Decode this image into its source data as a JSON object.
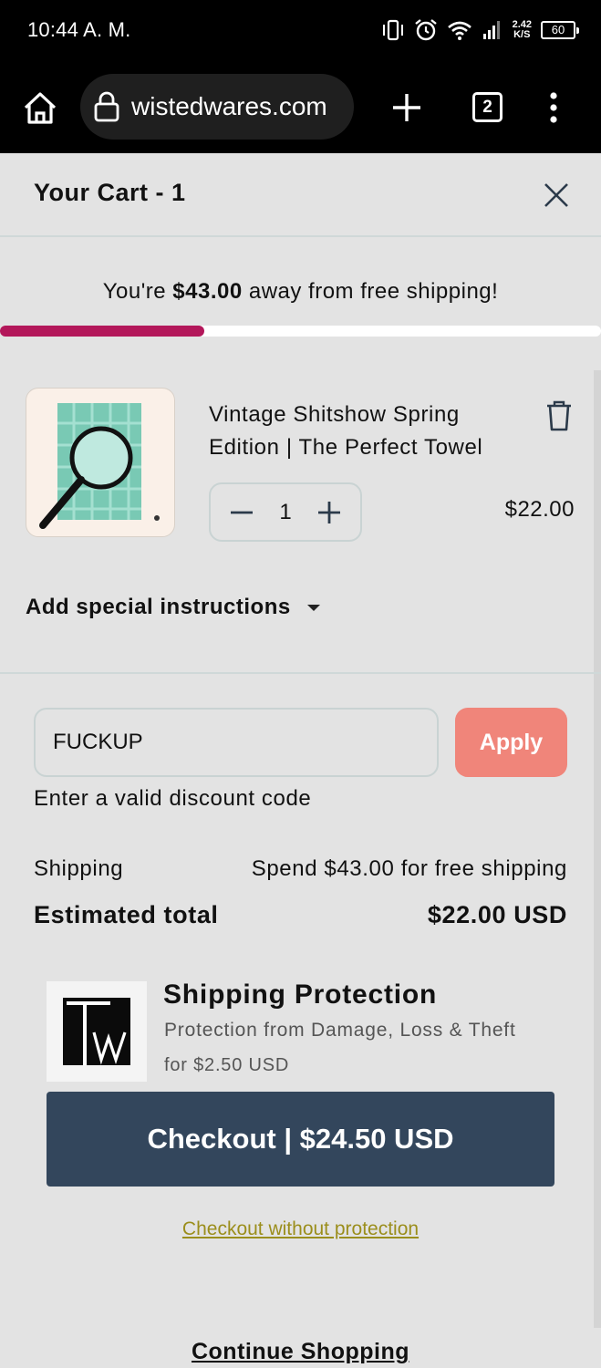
{
  "status_bar": {
    "time": "10:44 A. M.",
    "speed_value": "2.42",
    "speed_unit": "K/S",
    "battery": "60",
    "icons": [
      "vibrate-icon",
      "alarm-icon",
      "wifi-icon",
      "signal-icon"
    ]
  },
  "browser": {
    "url": "wistedwares.com",
    "tab_count": "2",
    "icons": [
      "home-icon",
      "lock-icon",
      "new-tab-plus-icon",
      "overflow-menu-icon"
    ]
  },
  "cart": {
    "title": "Your Cart - 1",
    "free_shipping": {
      "prefix": "You're ",
      "amount": "$43.00",
      "suffix": " away from free shipping!",
      "progress_fraction": 0.34
    },
    "item": {
      "name": "Vintage Shitshow Spring Edition | The Perfect Towel",
      "quantity": "1",
      "price": "$22.00"
    },
    "special_instructions_label": "Add special instructions",
    "discount": {
      "value": "FUCKUP",
      "apply_label": "Apply",
      "error": "Enter a valid discount code"
    },
    "shipping_label": "Shipping",
    "shipping_value": "Spend $43.00 for free shipping",
    "total_label": "Estimated total",
    "total_value": "$22.00 USD",
    "protection": {
      "title": "Shipping Protection",
      "description": "Protection from Damage, Loss & Theft",
      "price": "for $2.50 USD"
    },
    "checkout_label": "Checkout | $24.50 USD",
    "checkout_without_protection": "Checkout without protection",
    "continue_shopping": "Continue Shopping"
  },
  "colors": {
    "progress": "#b3175a",
    "apply_button": "#f0857a",
    "checkout_button": "#33465c",
    "link_no_protection": "#9b8e1c"
  }
}
